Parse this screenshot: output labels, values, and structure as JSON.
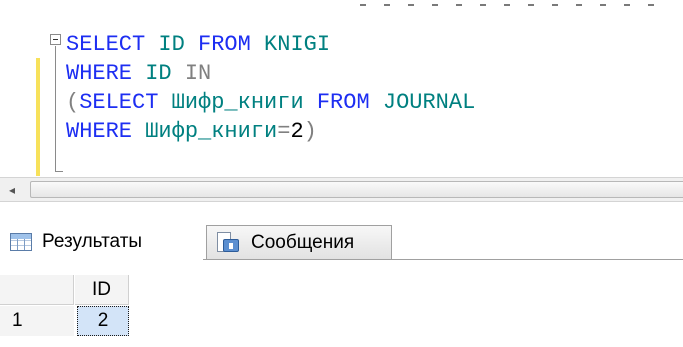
{
  "editor": {
    "lines": [
      [
        {
          "cls": "kw",
          "text": "SELECT "
        },
        {
          "cls": "id",
          "text": "ID "
        },
        {
          "cls": "kw",
          "text": "FROM "
        },
        {
          "cls": "id",
          "text": "KNIGI"
        }
      ],
      [
        {
          "cls": "kw",
          "text": "WHERE "
        },
        {
          "cls": "id",
          "text": "ID "
        },
        {
          "cls": "gr",
          "text": "IN"
        }
      ],
      [
        {
          "cls": "gr",
          "text": "("
        },
        {
          "cls": "kw",
          "text": "SELECT "
        },
        {
          "cls": "id",
          "text": "Шифр_книги "
        },
        {
          "cls": "kw",
          "text": "FROM "
        },
        {
          "cls": "id",
          "text": "JOURNAL"
        }
      ],
      [
        {
          "cls": "kw",
          "text": "WHERE "
        },
        {
          "cls": "id",
          "text": "Шифр_книги"
        },
        {
          "cls": "gr",
          "text": "="
        },
        {
          "cls": "tx",
          "text": "2"
        },
        {
          "cls": "gr",
          "text": ")"
        }
      ]
    ]
  },
  "scrollbar": {
    "left_arrow": "◂"
  },
  "tabs": {
    "results_label": "Результаты",
    "messages_label": "Сообщения"
  },
  "grid": {
    "columns": [
      "ID"
    ],
    "rows": [
      {
        "num": "1",
        "values": [
          "2"
        ]
      }
    ]
  },
  "icons": {
    "results": "grid-icon",
    "messages": "messages-icon",
    "collapse": "collapse-minus-icon",
    "scroll_left": "chevron-left-icon"
  },
  "colors": {
    "keyword": "#1d2ef2",
    "identifier": "#008080",
    "operator": "#808080",
    "change_bar": "#f7e15a",
    "selected_cell": "#d3e4f8"
  }
}
